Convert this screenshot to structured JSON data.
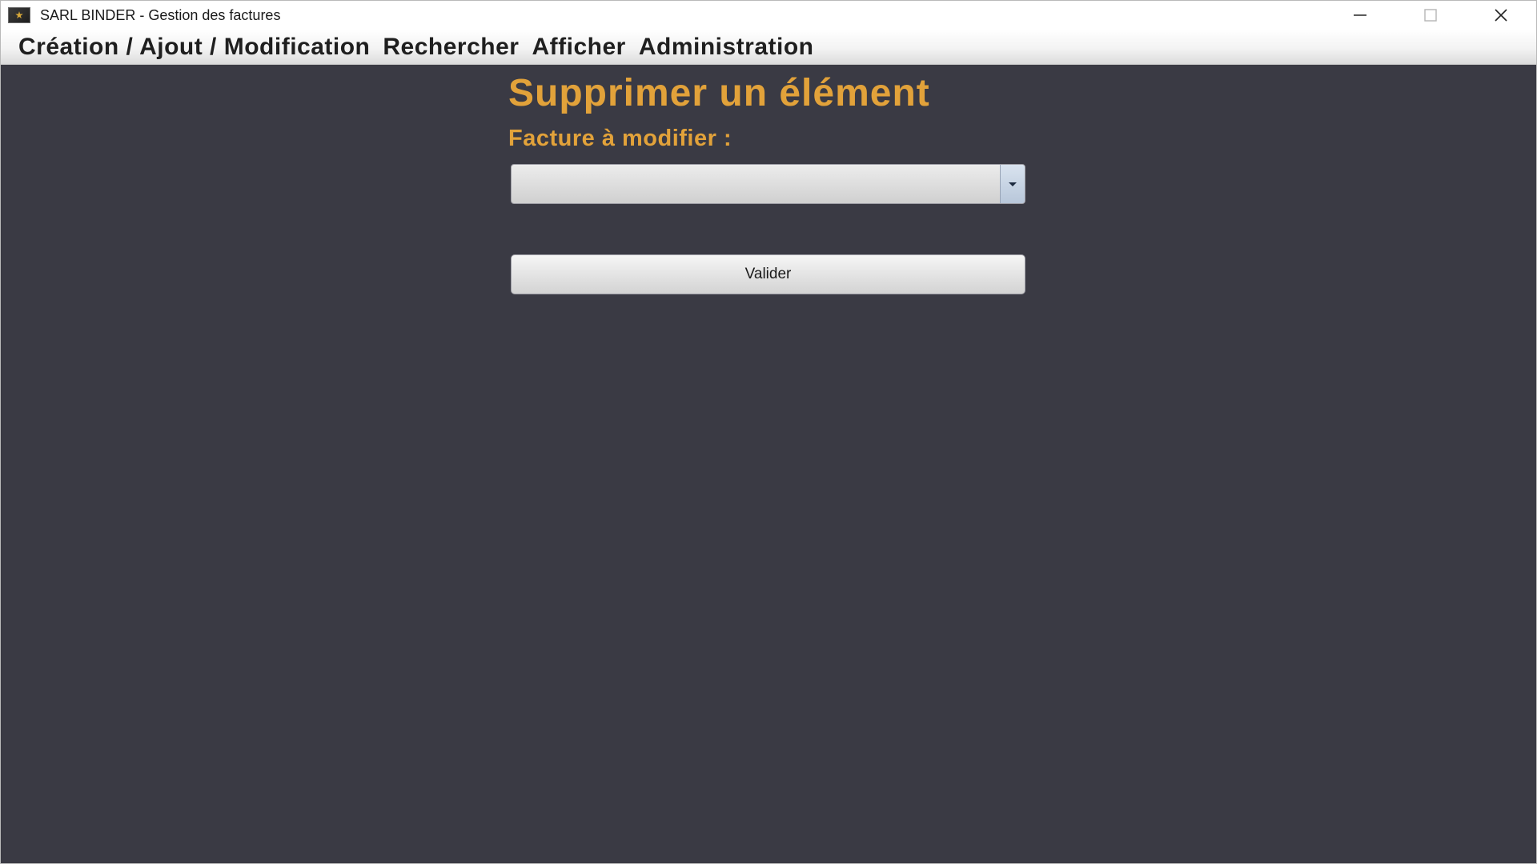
{
  "window": {
    "title": "SARL BINDER - Gestion des factures",
    "icon": "app-star-icon",
    "controls": [
      "minimize-icon",
      "maximize-icon",
      "close-icon"
    ]
  },
  "menubar": {
    "items": [
      {
        "label": "Création / Ajout / Modification"
      },
      {
        "label": "Rechercher"
      },
      {
        "label": "Afficher"
      },
      {
        "label": "Administration"
      }
    ]
  },
  "form": {
    "heading": "Supprimer un élément",
    "invoice_label": "Facture à modifier :",
    "invoice_select": {
      "value": "",
      "icon": "chevron-down-icon"
    },
    "submit_label": "Valider"
  },
  "colors": {
    "background": "#3a3a44",
    "accent": "#e2a23a"
  }
}
